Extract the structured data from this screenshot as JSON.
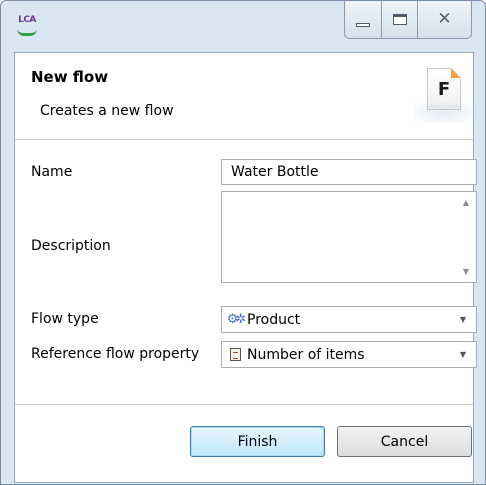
{
  "window": {
    "app_logo_text": "LCA",
    "controls": {
      "minimize": "minimize-icon",
      "maximize": "maximize-icon",
      "close": "close-icon"
    }
  },
  "banner": {
    "title": "New flow",
    "subtitle": "Creates a new flow",
    "icon_letter": "F"
  },
  "form": {
    "name_label": "Name",
    "name_value": "Water Bottle",
    "description_label": "Description",
    "description_value": "",
    "flow_type_label": "Flow type",
    "flow_type_value": "Product",
    "flow_type_icon": "product-gear-icon",
    "ref_property_label": "Reference flow property",
    "ref_property_value": "Number of items",
    "ref_property_icon": "flow-property-icon"
  },
  "buttons": {
    "finish": "Finish",
    "cancel": "Cancel"
  },
  "colors": {
    "frame": "#dbe6f3",
    "finish_border": "#3c7fb1",
    "finish_fill": "#bde6fd"
  }
}
